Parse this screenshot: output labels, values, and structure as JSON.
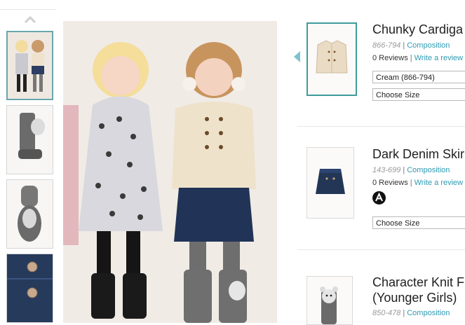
{
  "products": [
    {
      "title": "Chunky Cardiga",
      "code": "866-794",
      "composition": "Composition",
      "reviews": "0 Reviews",
      "write_review": "Write a review",
      "colour_select": "Cream (866-794)",
      "size_select": "Choose Size"
    },
    {
      "title": "Dark Denim Skir",
      "code": "143-699",
      "composition": "Composition",
      "reviews": "0 Reviews",
      "write_review": "Write a review",
      "size_select": "Choose Size"
    },
    {
      "title_line1": "Character Knit F",
      "title_line2": "(Younger Girls)",
      "code": "850-478",
      "composition": "Composition"
    }
  ],
  "colors": {
    "accent_teal": "#3f9c9a",
    "link": "#2d9bb3",
    "code_grey": "#9a9a9a"
  },
  "icons": {
    "scroll_up": "chevron-up-icon",
    "delivery_badge": "a-badge-icon"
  }
}
